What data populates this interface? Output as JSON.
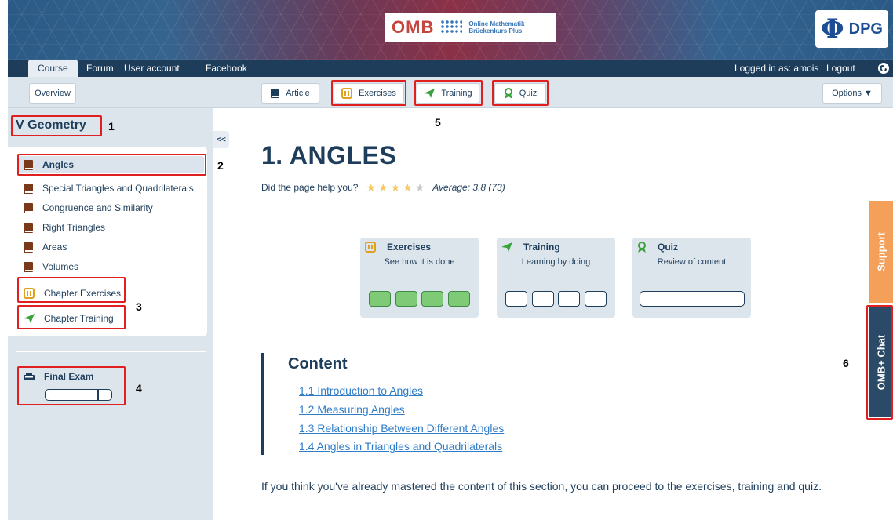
{
  "banner": {
    "omb_logo": "OMB",
    "omb_line1": "Online Mathematik",
    "omb_line2": "Brückenkurs Plus",
    "dpg_symbol": "Φ",
    "dpg_logo": "DPG"
  },
  "nav": {
    "tabs": [
      {
        "label": "Course",
        "active": true
      },
      {
        "label": "Forum"
      },
      {
        "label": "User account"
      },
      {
        "label": "Facebook"
      }
    ],
    "logged_in": "Logged in as: amois",
    "logout": "Logout",
    "globe_icon": "globe-icon"
  },
  "subnav": {
    "overview": "Overview",
    "article": "Article",
    "exercises": "Exercises",
    "training": "Training",
    "quiz": "Quiz",
    "options": "Options ▼"
  },
  "sidebar": {
    "chapter": "V Geometry",
    "collapse": "<<",
    "items": [
      {
        "label": "Angles",
        "icon": "book-icon",
        "active": true
      },
      {
        "label": "Special Triangles and Quadrilaterals",
        "icon": "book-icon"
      },
      {
        "label": "Congruence and Similarity",
        "icon": "book-icon"
      },
      {
        "label": "Right Triangles",
        "icon": "book-icon"
      },
      {
        "label": "Areas",
        "icon": "book-icon"
      },
      {
        "label": "Volumes",
        "icon": "book-icon"
      },
      {
        "label": "Chapter Exercises",
        "icon": "exercises-icon"
      },
      {
        "label": "Chapter Training",
        "icon": "training-icon"
      }
    ],
    "final_exam": "Final Exam",
    "final_exam_progress": 0.8
  },
  "main": {
    "title": "1. ANGLES",
    "help_question": "Did the page help you?",
    "rating_stars_filled": 4,
    "rating_stars_total": 5,
    "average": "Average: 3.8 (73)",
    "cards": [
      {
        "title": "Exercises",
        "subtitle": "See how it is done",
        "icon": "exercises-icon",
        "completed": 4,
        "total": 4
      },
      {
        "title": "Training",
        "subtitle": "Learning by doing",
        "icon": "training-icon",
        "completed": 0,
        "total": 4
      },
      {
        "title": "Quiz",
        "subtitle": "Review of content",
        "icon": "quiz-icon",
        "progress": 0
      }
    ],
    "content_title": "Content",
    "toc": [
      "1.1  Introduction to Angles",
      "1.2  Measuring Angles",
      "1.3  Relationship Between Different Angles",
      "1.4  Angles in Triangles and Quadrilaterals"
    ],
    "footer": "If you think you've already mastered the content of this section, you can proceed to the exercises, training and quiz."
  },
  "side_tabs": {
    "support": "Support",
    "chat": "OMB+ Chat"
  },
  "annotations": [
    "1",
    "2",
    "3",
    "4",
    "5",
    "6"
  ],
  "colors": {
    "navy": "#1d3d5b",
    "link": "#2f7cc8",
    "highlight": "#e02020",
    "done_green": "#7fca77",
    "support_orange": "#f5a05a"
  }
}
